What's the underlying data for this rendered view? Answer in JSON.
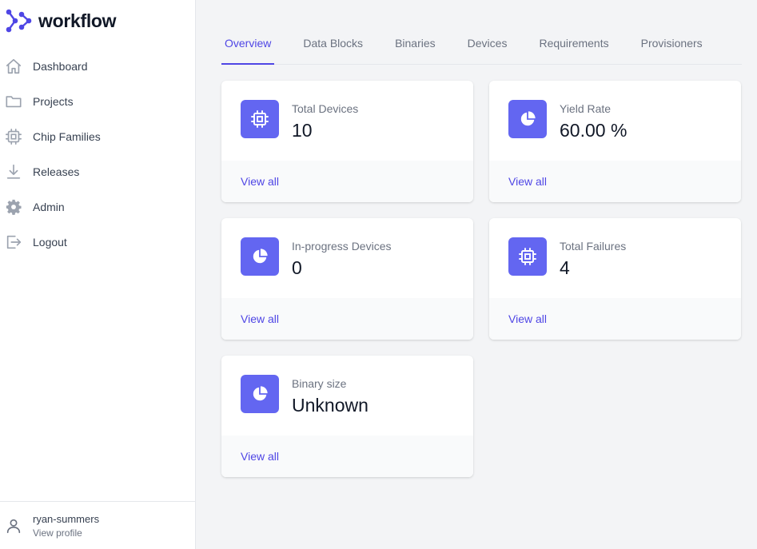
{
  "brand": {
    "name": "workflow",
    "logo_icon": "workflow-logo-icon",
    "accent": "#4f46e5"
  },
  "sidebar": {
    "items": [
      {
        "label": "Dashboard",
        "icon": "home-icon"
      },
      {
        "label": "Projects",
        "icon": "folder-icon"
      },
      {
        "label": "Chip Families",
        "icon": "chip-icon"
      },
      {
        "label": "Releases",
        "icon": "download-icon"
      },
      {
        "label": "Admin",
        "icon": "gear-icon"
      },
      {
        "label": "Logout",
        "icon": "logout-icon"
      }
    ],
    "profile": {
      "name": "ryan-summers",
      "link": "View profile",
      "icon": "user-icon"
    }
  },
  "tabs": [
    {
      "label": "Overview",
      "active": true
    },
    {
      "label": "Data Blocks"
    },
    {
      "label": "Binaries"
    },
    {
      "label": "Devices"
    },
    {
      "label": "Requirements"
    },
    {
      "label": "Provisioners"
    }
  ],
  "cards": [
    {
      "label": "Total Devices",
      "value": "10",
      "link": "View all",
      "icon": "chip-icon"
    },
    {
      "label": "Yield Rate",
      "value": "60.00 %",
      "link": "View all",
      "icon": "pie-chart-icon"
    },
    {
      "label": "In-progress Devices",
      "value": "0",
      "link": "View all",
      "icon": "pie-chart-icon"
    },
    {
      "label": "Total Failures",
      "value": "4",
      "link": "View all",
      "icon": "chip-icon"
    },
    {
      "label": "Binary size",
      "value": "Unknown",
      "link": "View all",
      "icon": "pie-chart-icon"
    }
  ],
  "colors": {
    "card_icon_bg": "#6366f1",
    "link": "#4f46e5",
    "page_bg": "#f3f4f6"
  }
}
